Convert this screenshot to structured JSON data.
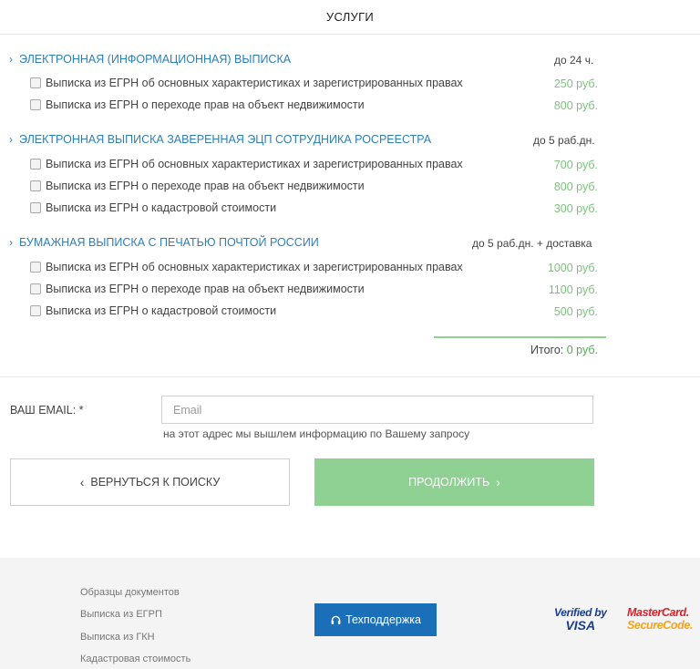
{
  "header": {
    "title": "УСЛУГИ"
  },
  "groups": [
    {
      "title": "ЭЛЕКТРОННАЯ (ИНФОРМАЦИОННАЯ) ВЫПИСКА",
      "term": "до 24 ч.",
      "items": [
        {
          "label": "Выписка из ЕГРН об основных характеристиках и зарегистрированных правах",
          "price": "250 руб.",
          "checked": false
        },
        {
          "label": "Выписка из ЕГРН о переходе прав на объект недвижимости",
          "price": "800 руб.",
          "checked": false
        }
      ]
    },
    {
      "title": "ЭЛЕКТРОННАЯ ВЫПИСКА ЗАВЕРЕННАЯ ЭЦП СОТРУДНИКА РОСРЕЕСТРА",
      "term": "до 5 раб.дн.",
      "items": [
        {
          "label": "Выписка из ЕГРН об основных характеристиках и зарегистрированных правах",
          "price": "700 руб.",
          "checked": false
        },
        {
          "label": "Выписка из ЕГРН о переходе прав на объект недвижимости",
          "price": "800 руб.",
          "checked": false
        },
        {
          "label": "Выписка из ЕГРН о кадастровой стоимости",
          "price": "300 руб.",
          "checked": false
        }
      ]
    },
    {
      "title": "БУМАЖНАЯ ВЫПИСКА С ПЕЧАТЬЮ ПОЧТОЙ РОССИИ",
      "term": "до 5 раб.дн. + доставка",
      "items": [
        {
          "label": "Выписка из ЕГРН об основных характеристиках и зарегистрированных правах",
          "price": "1000 руб.",
          "checked": false
        },
        {
          "label": "Выписка из ЕГРН о переходе прав на объект недвижимости",
          "price": "1100 руб.",
          "checked": false
        },
        {
          "label": "Выписка из ЕГРН о кадастровой стоимости",
          "price": "500 руб.",
          "checked": false
        }
      ]
    }
  ],
  "total": {
    "label": "Итого:",
    "value": "0 руб."
  },
  "email": {
    "label": "ВАШ EMAIL: *",
    "placeholder": "Email",
    "value": "",
    "hint": "на этот адрес мы вышлем информацию по Вашему запросу"
  },
  "buttons": {
    "back": "ВЕРНУТЬСЯ К ПОИСКУ",
    "next": "ПРОДОЛЖИТЬ"
  },
  "footer": {
    "links": [
      "Образцы документов",
      "Выписка из ЕГРП",
      "Выписка из ГКН",
      "Кадастровая стоимость"
    ],
    "support": "Техподдержка",
    "visa": {
      "line1": "Verified by",
      "line2": "VISA"
    },
    "mastercard": {
      "line1": "MasterCard.",
      "line2": "SecureCode."
    }
  },
  "colors": {
    "accent_blue": "#2d7fb8",
    "price_green": "#7cc27b",
    "next_button": "#8fd193",
    "support_button": "#1a6fb8"
  }
}
